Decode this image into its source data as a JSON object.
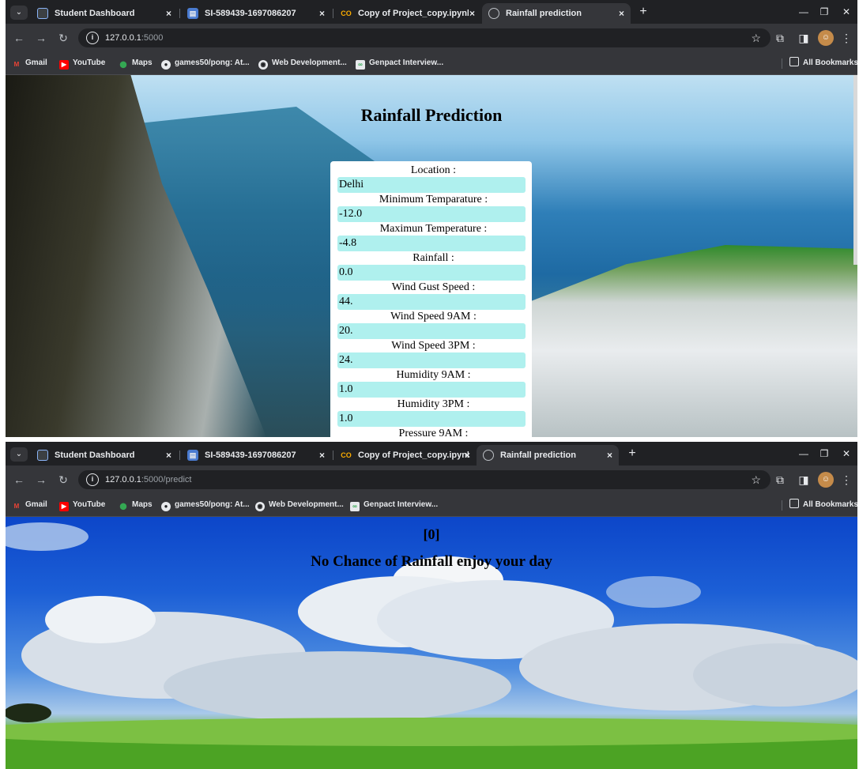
{
  "browser": {
    "tabs": [
      {
        "label": "Student Dashboard",
        "close": "×"
      },
      {
        "label": "SI-589439-1697086207",
        "close": "×"
      },
      {
        "label": "Copy of Project_copy.ipynb - C",
        "close": "×"
      },
      {
        "label": "Rainfall prediction",
        "close": "×"
      }
    ],
    "tab_search_icon": "chevron-down-icon",
    "new_tab_label": "+",
    "bookmarks": [
      "Gmail",
      "YouTube",
      "Maps",
      "games50/pong: At...",
      "Web Development...",
      "Genpact Interview..."
    ],
    "all_bookmarks": "All Bookmarks"
  },
  "shot1": {
    "url_host": "127.0.0.1",
    "url_rest": ":5000",
    "title": "Rainfall Prediction",
    "fields": [
      {
        "label": "Location :",
        "value": "Delhi"
      },
      {
        "label": "Minimum Temparature :",
        "value": "-12.0"
      },
      {
        "label": "Maximun Temperature :",
        "value": "-4.8"
      },
      {
        "label": "Rainfall :",
        "value": "0.0"
      },
      {
        "label": "Wind Gust Speed :",
        "value": "44."
      },
      {
        "label": "Wind Speed 9AM :",
        "value": "20."
      },
      {
        "label": "Wind Speed 3PM :",
        "value": "24."
      },
      {
        "label": "Humidity 9AM :",
        "value": "1.0"
      },
      {
        "label": "Humidity 3PM :",
        "value": "1.0"
      },
      {
        "label": "Pressure 9AM :",
        "value": ""
      }
    ]
  },
  "shot2": {
    "url_host": "127.0.0.1",
    "url_rest": ":5000/predict",
    "prediction": "[0]",
    "message": "No Chance of Rainfall enjoy your day"
  },
  "colors": {
    "chrome_dark": "#202124",
    "chrome_toolbar": "#35363a",
    "input_bg": "#aff0ee"
  }
}
